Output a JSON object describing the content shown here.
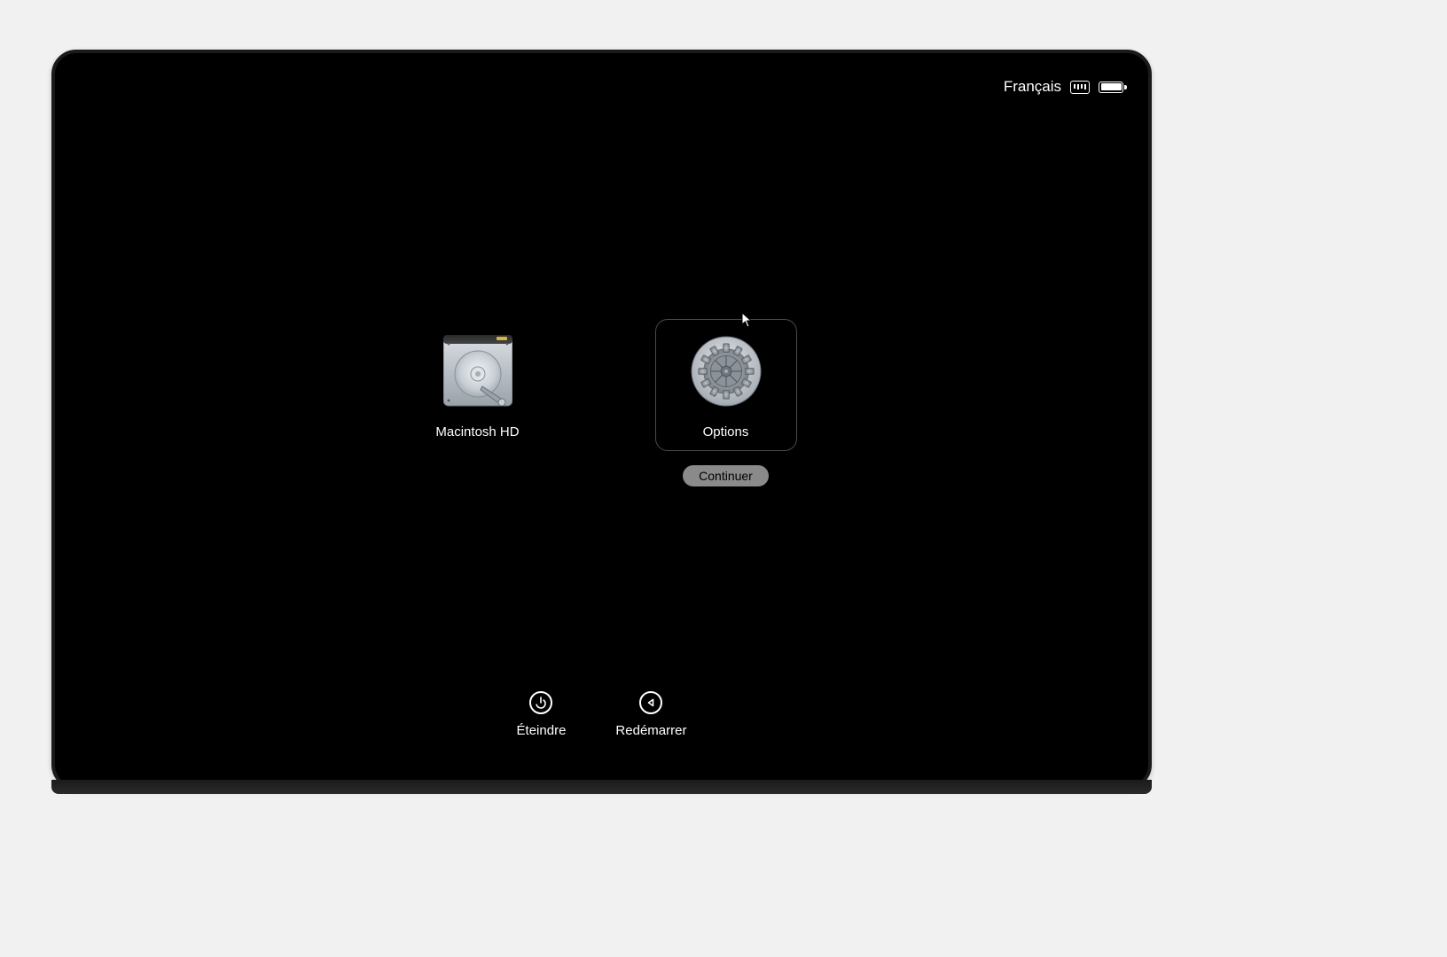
{
  "menubar": {
    "language": "Français"
  },
  "boot": {
    "items": [
      {
        "label": "Macintosh HD",
        "selected": false
      },
      {
        "label": "Options",
        "selected": true
      }
    ],
    "continue_label": "Continuer"
  },
  "actions": {
    "shutdown": "Éteindre",
    "restart": "Redémarrer"
  }
}
